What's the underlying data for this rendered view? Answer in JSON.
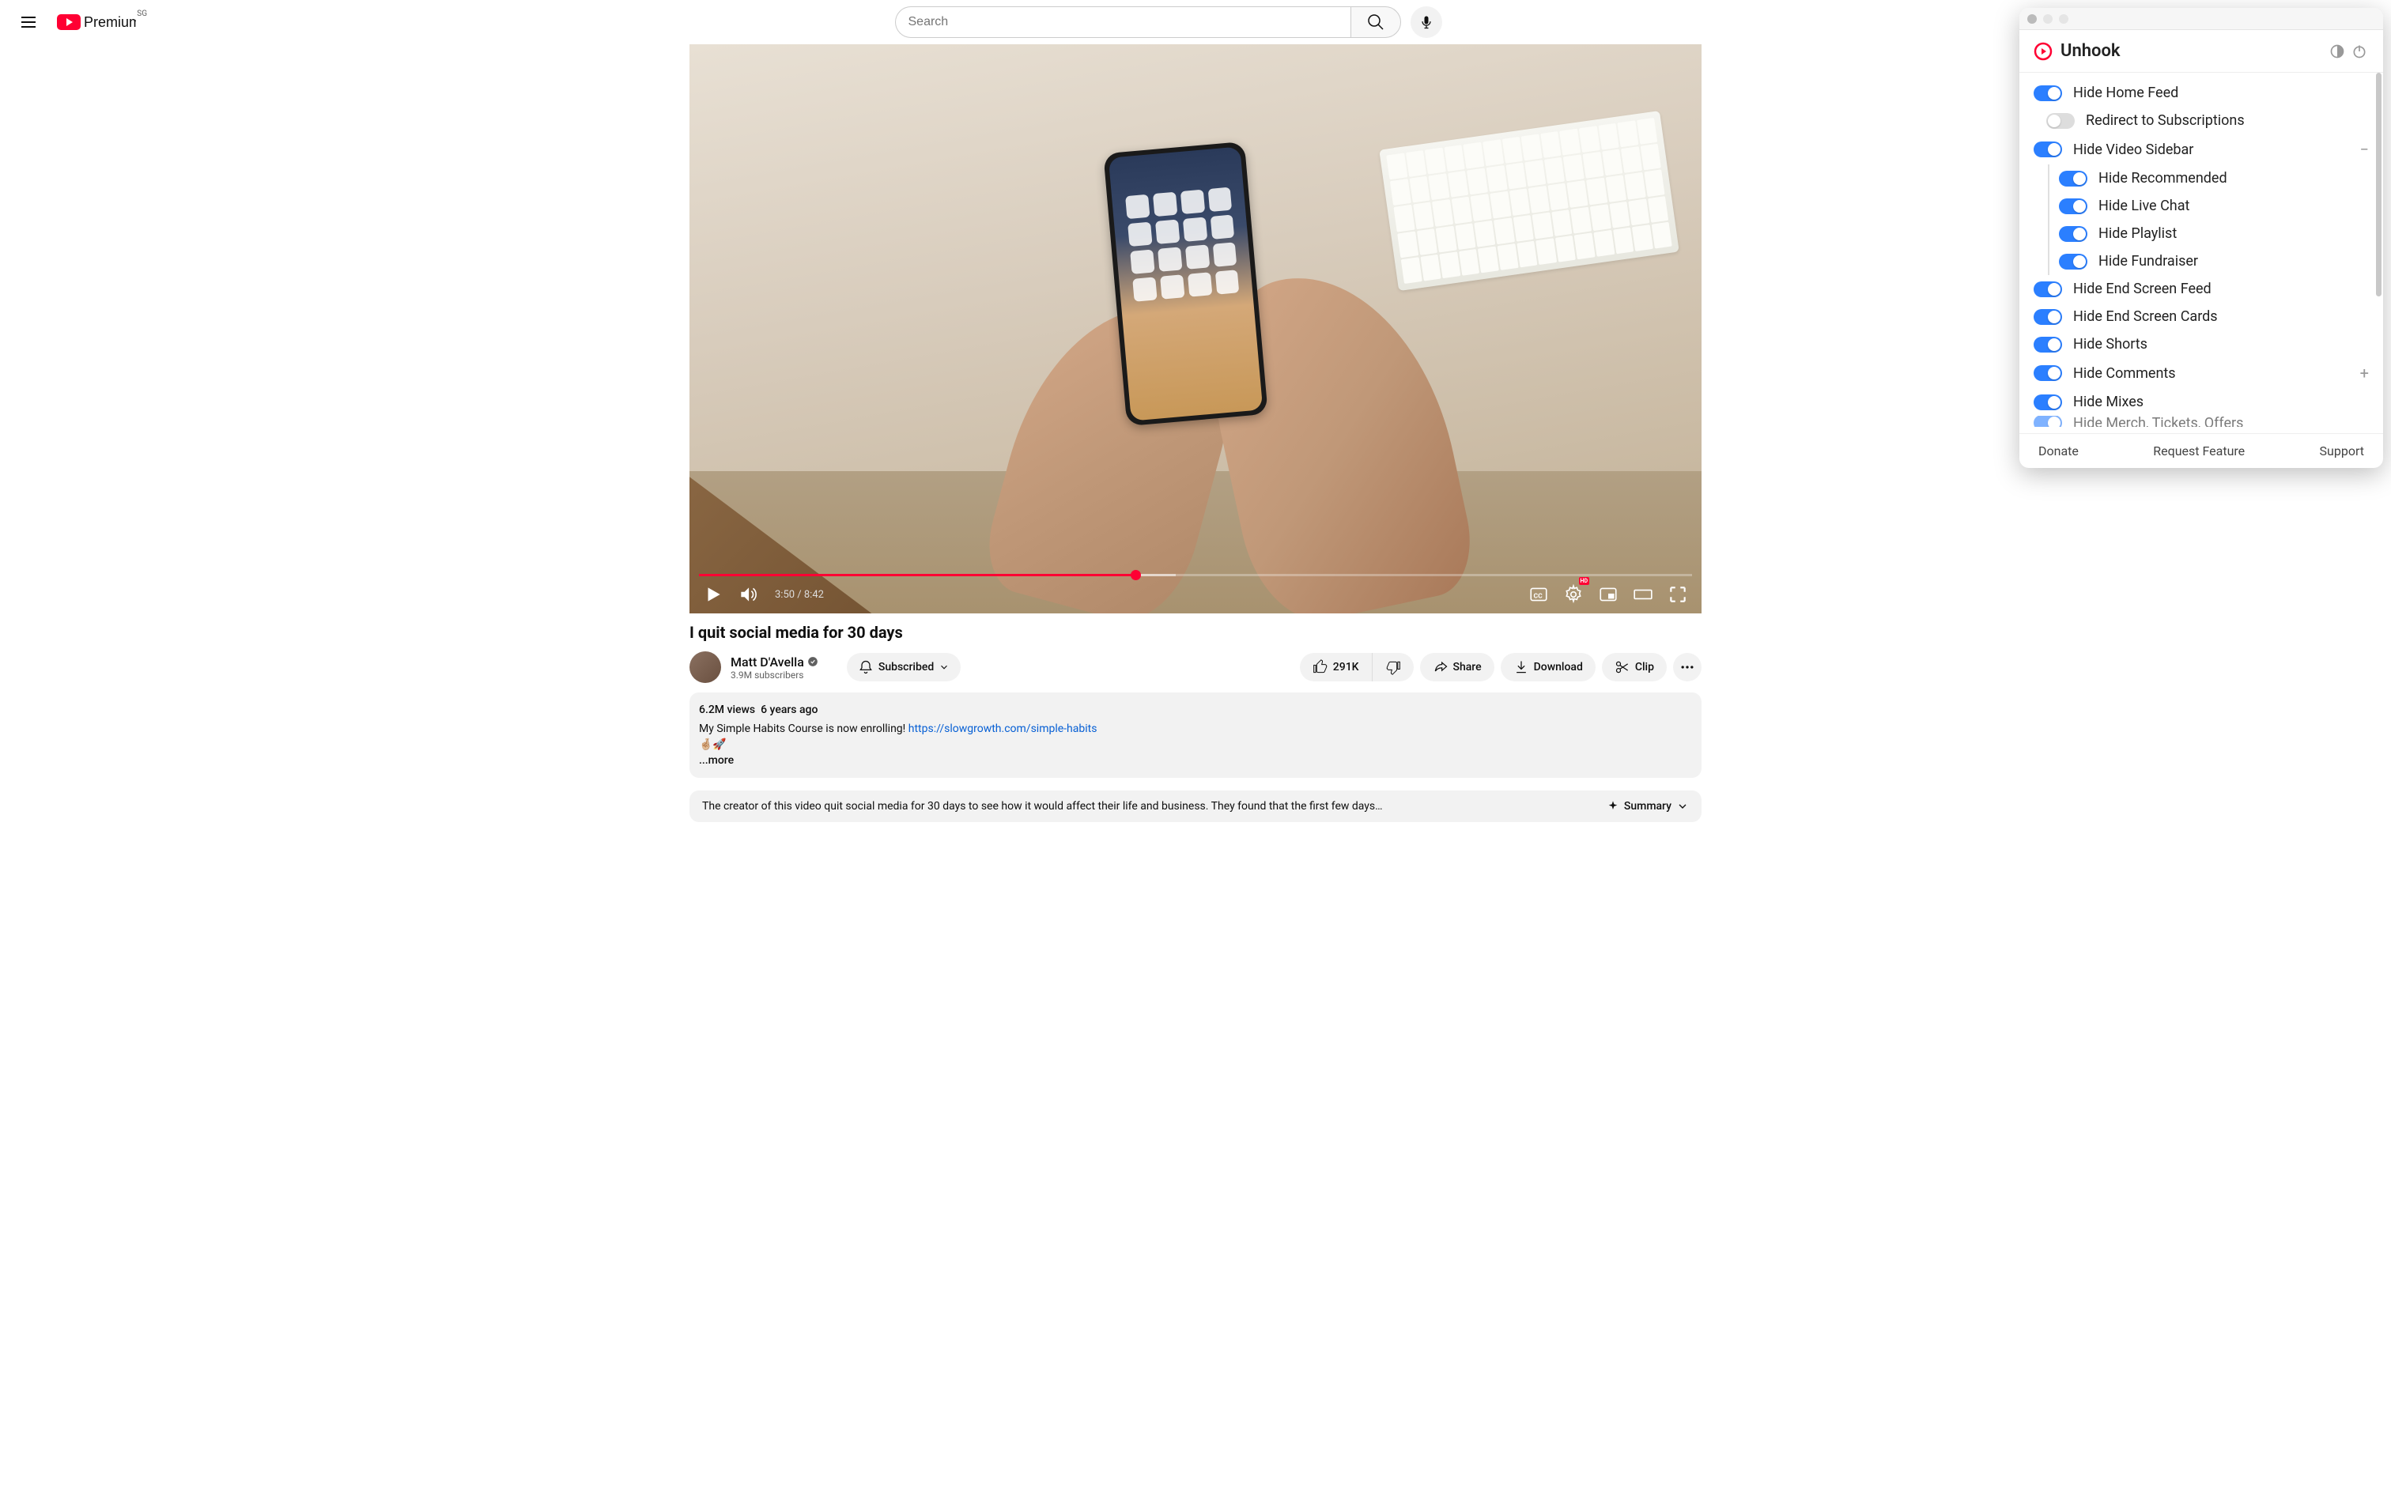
{
  "header": {
    "logo_text": "Premium",
    "region": "SG",
    "search_placeholder": "Search"
  },
  "player": {
    "current_time": "3:50",
    "duration": "8:42",
    "time_display": "3:50 / 8:42",
    "hd_badge": "HD"
  },
  "video": {
    "title": "I quit social media for 30 days",
    "channel_name": "Matt D'Avella",
    "subscribers": "3.9M subscribers",
    "subscribe_label": "Subscribed",
    "likes": "291K",
    "share_label": "Share",
    "download_label": "Download",
    "clip_label": "Clip"
  },
  "description": {
    "views": "6.2M views",
    "age": "6 years ago",
    "text_prefix": "My Simple Habits Course is now enrolling! ",
    "link": "https://slowgrowth.com/simple-habits",
    "emoji": "🤞🏼🚀",
    "more": "...more"
  },
  "summary": {
    "text": "The creator of this video quit social media for 30 days to see how it would affect their life and business. They found that the first few days…",
    "label": "Summary"
  },
  "extension": {
    "name": "Unhook",
    "footer": {
      "donate": "Donate",
      "request": "Request Feature",
      "support": "Support"
    },
    "toggles": [
      {
        "label": "Hide Home Feed",
        "on": true,
        "indent": 0
      },
      {
        "label": "Redirect to Subscriptions",
        "on": false,
        "indent": 1
      },
      {
        "label": "Hide Video Sidebar",
        "on": true,
        "indent": 0,
        "collapse": "minus"
      },
      {
        "label": "Hide Recommended",
        "on": true,
        "indent": 2
      },
      {
        "label": "Hide Live Chat",
        "on": true,
        "indent": 2
      },
      {
        "label": "Hide Playlist",
        "on": true,
        "indent": 2
      },
      {
        "label": "Hide Fundraiser",
        "on": true,
        "indent": 2
      },
      {
        "label": "Hide End Screen Feed",
        "on": true,
        "indent": 0
      },
      {
        "label": "Hide End Screen Cards",
        "on": true,
        "indent": 0
      },
      {
        "label": "Hide Shorts",
        "on": true,
        "indent": 0
      },
      {
        "label": "Hide Comments",
        "on": true,
        "indent": 0,
        "collapse": "plus"
      },
      {
        "label": "Hide Mixes",
        "on": true,
        "indent": 0
      },
      {
        "label": "Hide Merch, Tickets, Offers",
        "on": true,
        "indent": 0,
        "partial": true
      }
    ]
  }
}
